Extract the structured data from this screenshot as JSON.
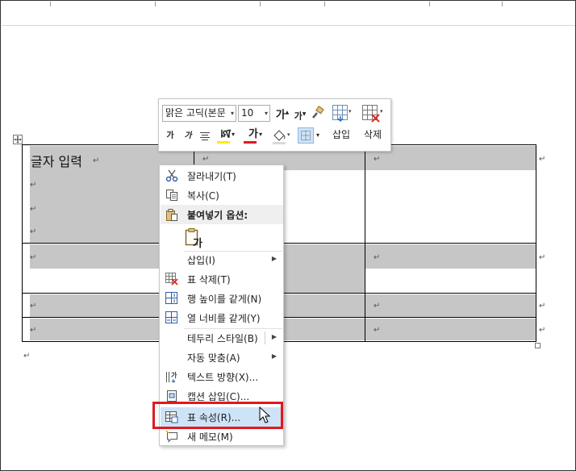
{
  "table": {
    "first_cell_text": "글자 입력",
    "shade_color": "#c6c6c6"
  },
  "mini_toolbar": {
    "font_name": "맑은 고딕(본문",
    "font_size": "10",
    "grow_font_glyph": "가",
    "shrink_font_glyph": "가",
    "insert_label": "삽입",
    "delete_label": "삭제"
  },
  "context_menu": {
    "items": [
      {
        "label": "잘라내기(T)",
        "icon": "scissors-icon"
      },
      {
        "label": "복사(C)",
        "icon": "copy-icon"
      },
      {
        "label": "붙여넣기 옵션:",
        "icon": "clipboard-icon"
      },
      {
        "label": "가",
        "icon": "paste-keep-text-icon"
      },
      {
        "label": "삽입(I)",
        "icon": "none",
        "submenu": true
      },
      {
        "label": "표 삭제(T)",
        "icon": "delete-table-icon"
      },
      {
        "label": "행 높이를 같게(N)",
        "icon": "distribute-rows-icon"
      },
      {
        "label": "열 너비를 같게(Y)",
        "icon": "distribute-columns-icon"
      },
      {
        "label": "테두리 스타일(B)",
        "icon": "none",
        "submenu": true
      },
      {
        "label": "자동 맞춤(A)",
        "icon": "none",
        "submenu": true
      },
      {
        "label": "텍스트 방향(X)...",
        "icon": "text-direction-icon"
      },
      {
        "label": "캡션 삽입(C)...",
        "icon": "insert-caption-icon"
      },
      {
        "label": "표 속성(R)...",
        "icon": "table-properties-icon"
      },
      {
        "label": "새 메모(M)",
        "icon": "new-comment-icon"
      }
    ],
    "highlight_color": "#cde3f7",
    "callout_color": "#e0191f"
  }
}
